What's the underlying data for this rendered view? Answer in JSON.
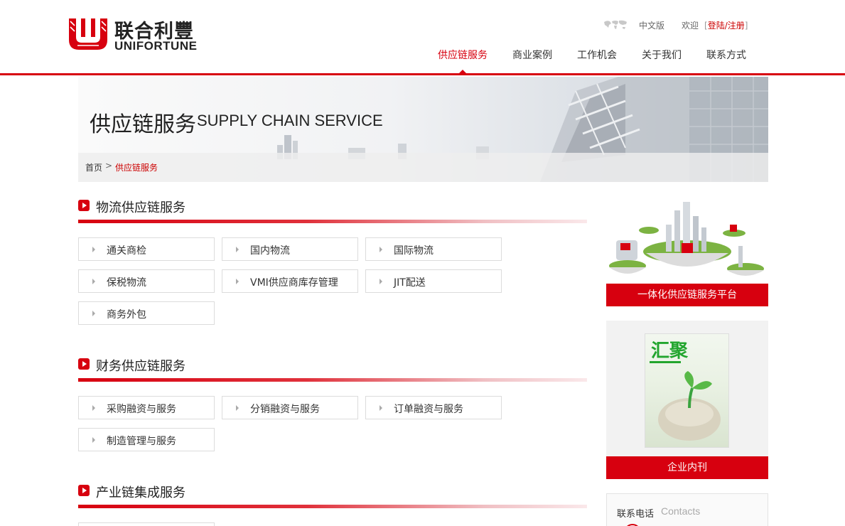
{
  "header": {
    "logo_cn": "联合利豐",
    "logo_en": "UNIFORTUNE",
    "lang": "中文版",
    "welcome": "欢迎",
    "login_open": "[",
    "login_link": "登陆/注册",
    "login_close": "]",
    "nav": [
      "供应链服务",
      "商业案例",
      "工作机会",
      "关于我们",
      "联系方式"
    ]
  },
  "banner": {
    "title": "供应链服务",
    "title_en": "SUPPLY CHAIN SERVICE",
    "breadcrumb": {
      "home": "首页",
      "separator": ">",
      "current": "供应链服务"
    }
  },
  "sections": [
    {
      "title": "物流供应链服务",
      "items": [
        "通关商检",
        "国内物流",
        "国际物流",
        "保税物流",
        "VMI供应商库存管理",
        "JIT配送",
        "商务外包"
      ]
    },
    {
      "title": "财务供应链服务",
      "items": [
        "采购融资与服务",
        "分销融资与服务",
        "订单融资与服务",
        "制造管理与服务"
      ]
    },
    {
      "title": "产业链集成服务",
      "items": []
    }
  ],
  "sidebar": {
    "platform_label": "一体化供应链服务平台",
    "magazine_cover_title": "汇聚",
    "magazine_label": "企业内刊",
    "contact_cn": "联系电话",
    "contact_en": "Contacts"
  },
  "colors": {
    "brand_red": "#d7000f",
    "magazine_green": "#22a52e"
  }
}
